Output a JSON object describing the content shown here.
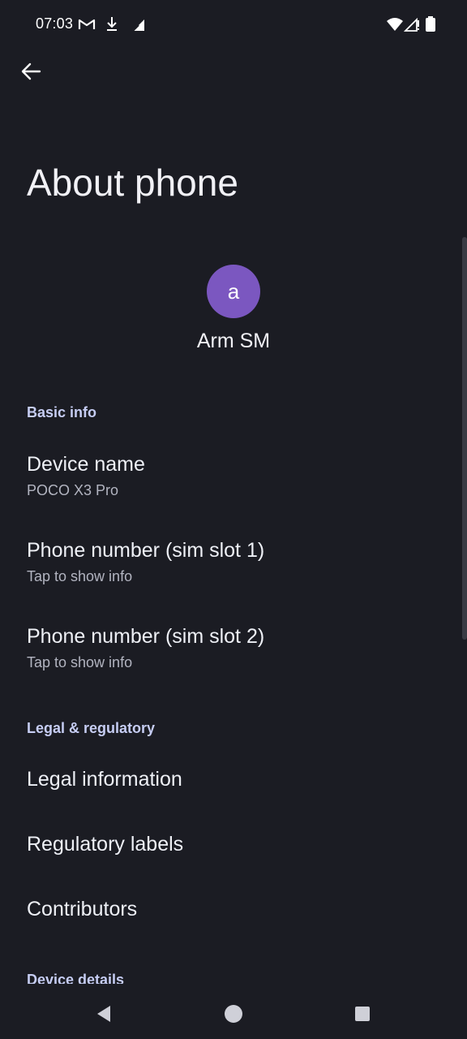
{
  "status_bar": {
    "time": "07:03",
    "icons": [
      "gmail-icon",
      "download-icon",
      "signal-no-service-icon",
      "wifi-icon",
      "cellular-signal-icon",
      "battery-icon"
    ]
  },
  "toolbar": {
    "back_icon": "arrow-left-icon"
  },
  "page": {
    "title": "About phone"
  },
  "profile": {
    "avatar_letter": "a",
    "avatar_color": "#7b57c0",
    "name": "Arm SM"
  },
  "sections": {
    "basic_info": "Basic info",
    "legal": "Legal & regulatory",
    "device_details": "Device details"
  },
  "items": {
    "device_name": {
      "title": "Device name",
      "subtitle": "POCO X3 Pro"
    },
    "phone_1": {
      "title": "Phone number (sim slot 1)",
      "subtitle": "Tap to show info"
    },
    "phone_2": {
      "title": "Phone number (sim slot 2)",
      "subtitle": "Tap to show info"
    },
    "legal_info": {
      "title": "Legal information"
    },
    "regulatory": {
      "title": "Regulatory labels"
    },
    "contributors": {
      "title": "Contributors"
    }
  },
  "colors": {
    "background": "#1b1c23",
    "section_header": "#c6cdf3",
    "accent": "#7b57c0"
  },
  "nav_bar": {
    "icons": [
      "back-triangle-icon",
      "home-circle-icon",
      "recents-square-icon"
    ]
  }
}
